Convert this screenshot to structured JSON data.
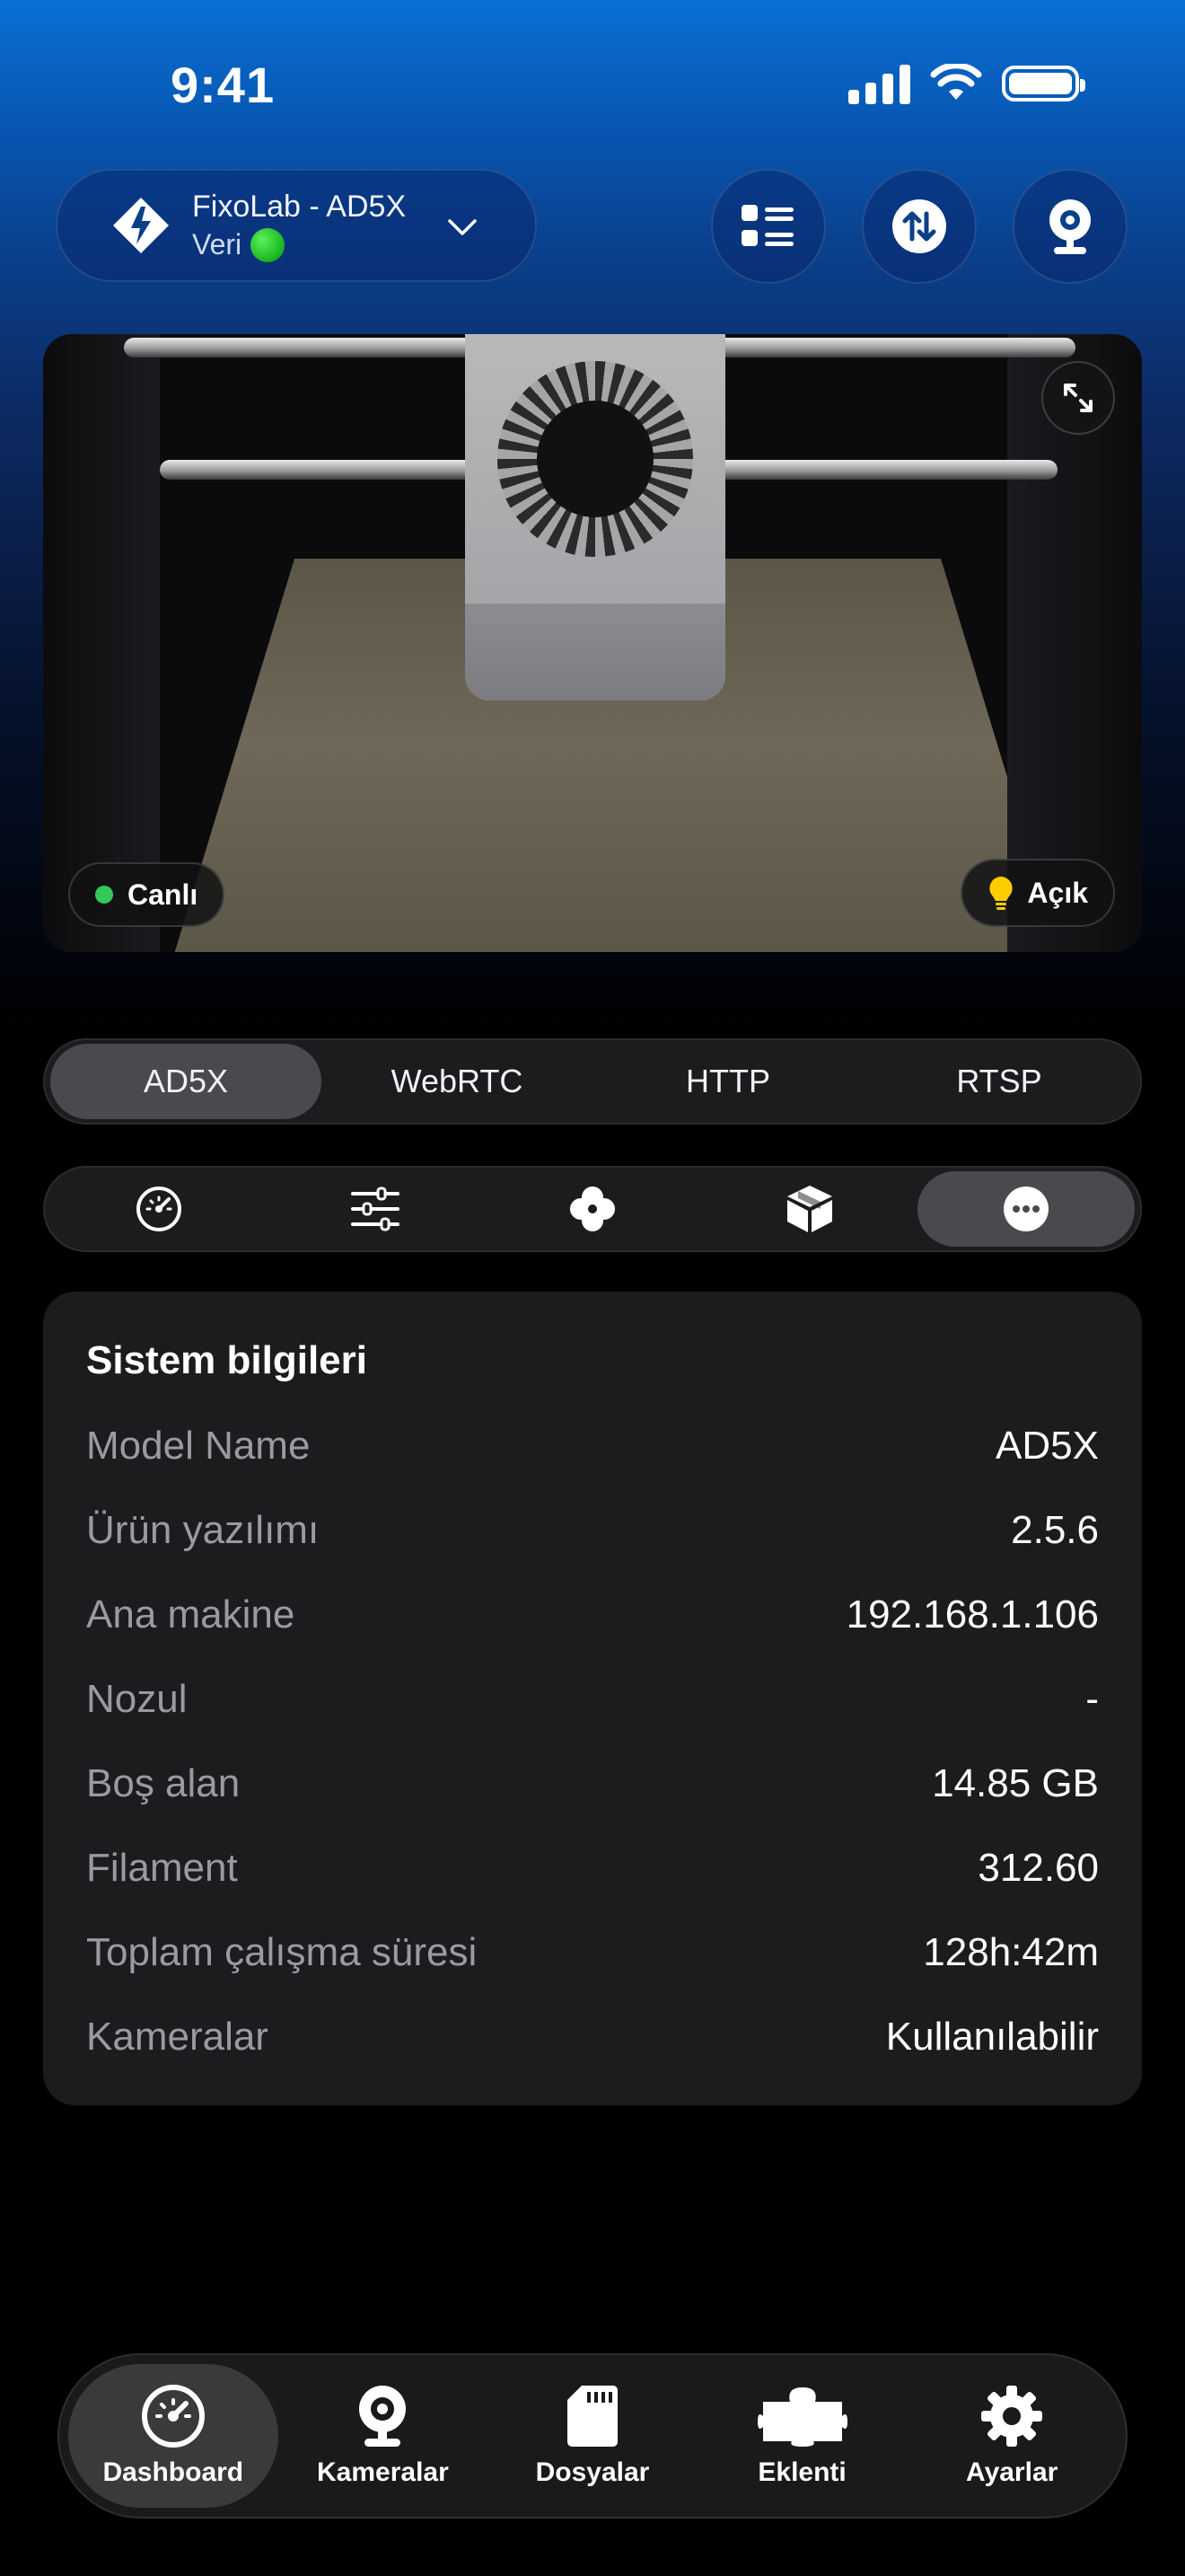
{
  "status_bar": {
    "time": "9:41"
  },
  "header": {
    "printer_name": "FixoLab - AD5X",
    "printer_status": "Veri"
  },
  "camera": {
    "live_label": "Canlı",
    "light_label": "Açık"
  },
  "stream_tabs": [
    {
      "label": "AD5X",
      "active": true
    },
    {
      "label": "WebRTC",
      "active": false
    },
    {
      "label": "HTTP",
      "active": false
    },
    {
      "label": "RTSP",
      "active": false
    }
  ],
  "control_tabs": [
    {
      "icon": "speedometer-icon",
      "active": false
    },
    {
      "icon": "sliders-icon",
      "active": false
    },
    {
      "icon": "fan-icon",
      "active": false
    },
    {
      "icon": "box-icon",
      "active": false
    },
    {
      "icon": "more-icon",
      "active": true
    }
  ],
  "system_info": {
    "title": "Sistem bilgileri",
    "rows": [
      {
        "label": "Model Name",
        "value": "AD5X"
      },
      {
        "label": "Ürün yazılımı",
        "value": "2.5.6"
      },
      {
        "label": "Ana makine",
        "value": "192.168.1.106"
      },
      {
        "label": "Nozul",
        "value": "-"
      },
      {
        "label": "Boş alan",
        "value": "14.85 GB"
      },
      {
        "label": "Filament",
        "value": "312.60"
      },
      {
        "label": "Toplam çalışma süresi",
        "value": "128h:42m"
      },
      {
        "label": "Kameralar",
        "value": "Kullanılabilir"
      }
    ]
  },
  "bottom_nav": [
    {
      "label": "Dashboard",
      "icon": "dashboard-icon",
      "active": true
    },
    {
      "label": "Kameralar",
      "icon": "camera-icon",
      "active": false
    },
    {
      "label": "Dosyalar",
      "icon": "sd-card-icon",
      "active": false
    },
    {
      "label": "Eklenti",
      "icon": "puzzle-icon",
      "active": false
    },
    {
      "label": "Ayarlar",
      "icon": "gear-icon",
      "active": false
    }
  ],
  "colors": {
    "accent_blue": "#0a6fd3",
    "status_green": "#34c759",
    "card_bg": "#1c1c1e",
    "label_gray": "#9a9aa0"
  }
}
